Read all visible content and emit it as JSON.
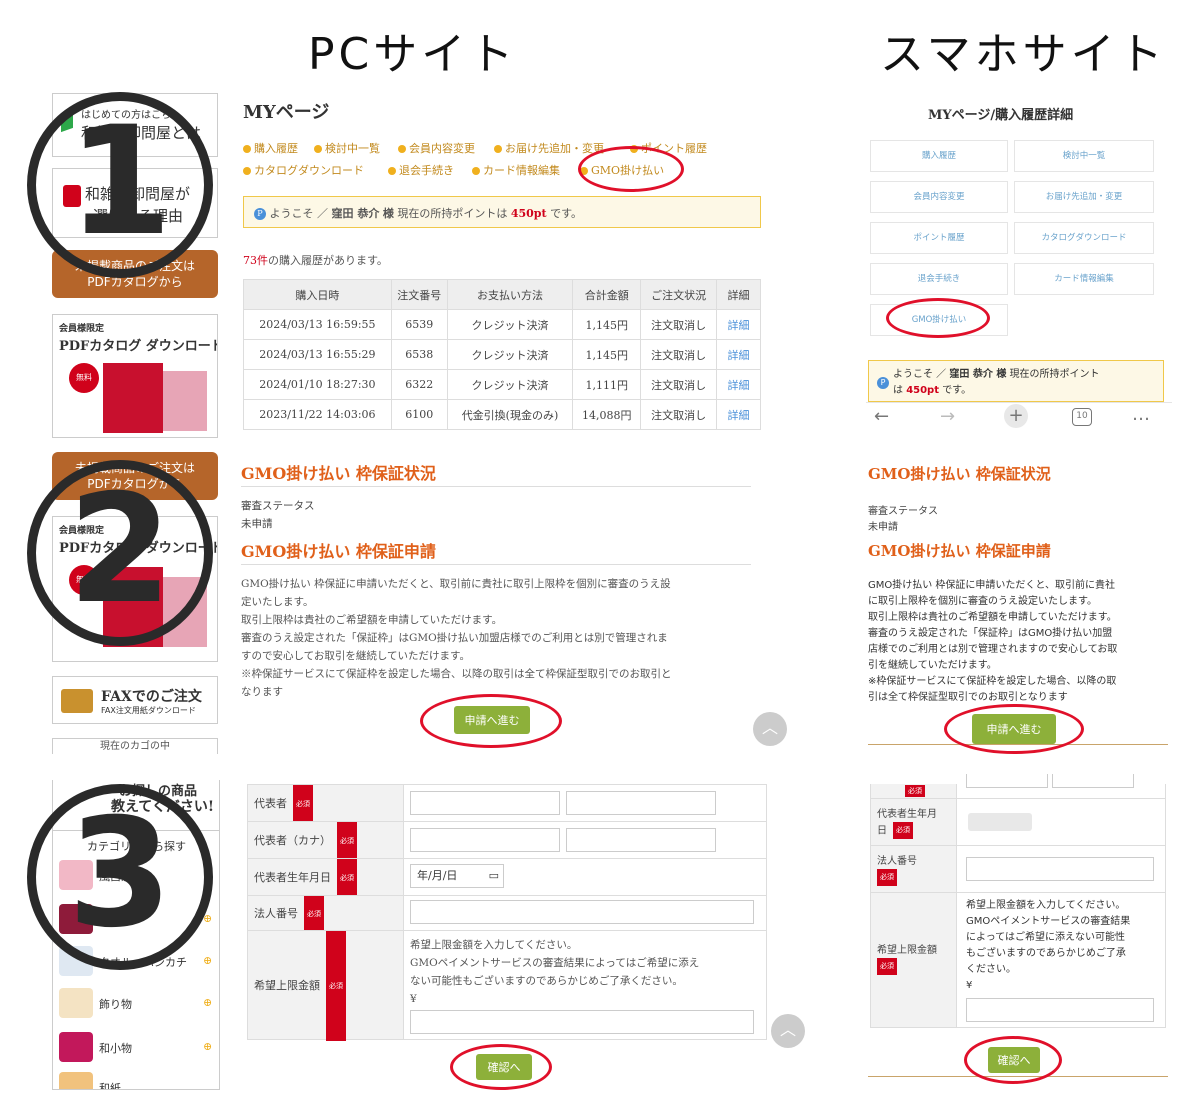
{
  "headings": {
    "pc": "PCサイト",
    "sp": "スマホサイト"
  },
  "step_numbers": [
    "1",
    "2",
    "3"
  ],
  "pc": {
    "sidebar": {
      "beginner_small": "はじめての方はこち",
      "beginner_title": "和雑貨卸問屋とは",
      "chosen_title": "和雑貨卸問屋が",
      "chosen_title2": "選ばれる理由",
      "ribbon1": "未掲載商品のご注文は",
      "ribbon1b": "PDFカタログから",
      "member_only": "会員様限定",
      "pdf_title": "PDFカタログ ダウンロード",
      "free": "無料",
      "ribbon2": "未掲載商品のご注文は",
      "ribbon2b": "PDFカタログから",
      "member_only2": "会員様限定",
      "pdf_title2": "PDFカタログ ダウンロード",
      "free2": "無料",
      "fax_title": "FAXでのご注文",
      "fax_sub": "FAX注文用紙ダウンロード",
      "cart": "現在のカゴの中",
      "teach": "教えてください!",
      "teach_top": "お探しの商品",
      "category": "カテゴリーから探す",
      "categories": [
        "風呂敷",
        "手拭い",
        "タオル・ハンカチ",
        "飾り物",
        "和小物",
        "和紙"
      ]
    },
    "mypage": {
      "title": "MYページ",
      "tabs_row1": [
        "購入履歴",
        "検討中一覧",
        "会員内容変更",
        "お届け先追加・変更",
        "ポイント履歴"
      ],
      "tabs_row2": [
        "カタログダウンロード",
        "退会手続き",
        "カード情報編集",
        "GMO掛け払い"
      ],
      "welcome_pre": "ようこそ ／",
      "welcome_name": "窪田 恭介",
      "welcome_sama": "様",
      "welcome_mid": "現在の所持ポイントは",
      "welcome_points": "450pt",
      "welcome_post": "です。",
      "count_num": "73件",
      "count_text": "の購入履歴があります。",
      "columns": [
        "購入日時",
        "注文番号",
        "お支払い方法",
        "合計金額",
        "ご注文状況",
        "詳細"
      ],
      "rows": [
        [
          "2024/03/13 16:59:55",
          "6539",
          "クレジット決済",
          "1,145円",
          "注文取消し",
          "詳細"
        ],
        [
          "2024/03/13 16:55:29",
          "6538",
          "クレジット決済",
          "1,145円",
          "注文取消し",
          "詳細"
        ],
        [
          "2024/01/10 18:27:30",
          "6322",
          "クレジット決済",
          "1,111円",
          "注文取消し",
          "詳細"
        ],
        [
          "2023/11/22 14:03:06",
          "6100",
          "代金引換(現金のみ)",
          "14,088円",
          "注文取消し",
          "詳細"
        ]
      ]
    },
    "gmo": {
      "status_title": "GMO掛け払い 枠保証状況",
      "status_label": "審査ステータス",
      "status_value": "未申請",
      "apply_title": "GMO掛け払い 枠保証申請",
      "p1": "GMO掛け払い 枠保証に申請いただくと、取引前に貴社に取引上限枠を個別に審査のうえ設",
      "p1b": "定いたします。",
      "p2": "取引上限枠は貴社のご希望額を申請していただけます。",
      "p3": "審査のうえ設定された「保証枠」はGMO掛け払い加盟店様でのご利用とは別で管理されま",
      "p3b": "すので安心してお取引を継続していただけます。",
      "p4": "※枠保証サービスにて保証枠を設定した場合、以降の取引は全て枠保証型取引でのお取引と",
      "p4b": "なります",
      "apply_btn": "申請へ進む"
    },
    "form": {
      "rep": "代表者",
      "rep_kana": "代表者（カナ）",
      "rep_birth": "代表者生年月日",
      "date_ph": "年/月/日",
      "corp_no": "法人番号",
      "limit": "希望上限金額",
      "limit_note1": "希望上限金額を入力してください。",
      "limit_note2": "GMOペイメントサービスの審査結果によってはご希望に添え",
      "limit_note3": "ない可能性もございますのであらかじめご了承ください。",
      "yen": "¥",
      "required": "必須",
      "confirm_btn": "確認へ"
    }
  },
  "sp": {
    "title": "MYページ/購入履歴詳細",
    "menu": [
      "購入履歴",
      "検討中一覧",
      "会員内容変更",
      "お届け先追加・変更",
      "ポイント履歴",
      "カタログダウンロード",
      "退会手続き",
      "カード情報編集",
      "GMO掛け払い"
    ],
    "welcome_pre": "ようこそ ／",
    "welcome_name": "窪田 恭介 様",
    "welcome_mid": "現在の所持ポイント",
    "welcome_ha": "は",
    "welcome_points": "450pt",
    "welcome_post": "です。",
    "tab_count": "10",
    "status_title": "GMO掛け払い 枠保証状況",
    "status_label": "審査ステータス",
    "status_value": "未申請",
    "apply_title": "GMO掛け払い 枠保証申請",
    "lines": [
      "GMO掛け払い 枠保証に申請いただくと、取引前に貴社",
      "に取引上限枠を個別に審査のうえ設定いたします。",
      "取引上限枠は貴社のご希望額を申請していただけます。",
      "審査のうえ設定された「保証枠」はGMO掛け払い加盟",
      "店様でのご利用とは別で管理されますので安心してお取",
      "引を継続していただけます。",
      "※枠保証サービスにて保証枠を設定した場合、以降の取",
      "引は全て枠保証型取引でのお取引となります"
    ],
    "apply_btn": "申請へ進む",
    "form": {
      "rep_birth1": "代表者生年月",
      "rep_birth2": "日",
      "corp_no": "法人番号",
      "limit": "希望上限金額",
      "required": "必須",
      "notes": [
        "希望上限金額を入力してください。",
        "GMOペイメントサービスの審査結果",
        "によってはご希望に添えない可能性",
        "もございますのであらかじめご了承",
        "ください。"
      ],
      "yen": "¥",
      "confirm_btn": "確認へ"
    }
  },
  "colors": {
    "accent_orange": "#e0601a",
    "button_green": "#8db03a",
    "oval_red": "#e0102a",
    "ribbon_brown": "#b5652a"
  }
}
